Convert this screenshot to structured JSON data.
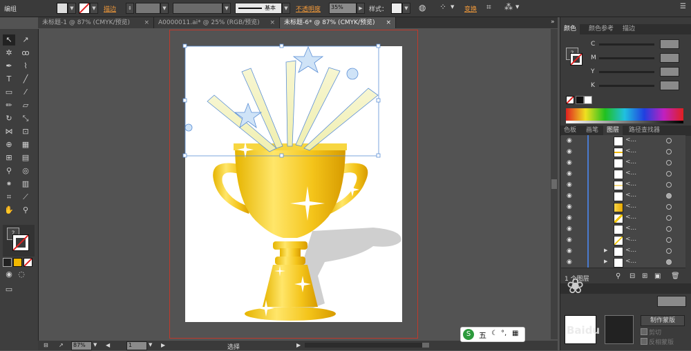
{
  "control_bar": {
    "label_group": "编组",
    "stroke_label": "描边",
    "stroke_style": "基本",
    "opacity_label": "不透明度",
    "opacity_value": "35%",
    "style_label": "样式：",
    "transform_label": "变换"
  },
  "tabs": [
    {
      "label": "未标题-1 @ 87% (CMYK/预览)",
      "close": "×"
    },
    {
      "label": "A0000011.ai* @ 25% (RGB/预览)",
      "close": "×"
    },
    {
      "label": "未标题-6* @ 87% (CMYK/预览)",
      "close": "×"
    }
  ],
  "color_panel": {
    "tabs": [
      "颜色",
      "颜色参考",
      "描边"
    ],
    "channels": [
      "C",
      "M",
      "Y",
      "K"
    ]
  },
  "layers_panel": {
    "tabs": [
      "色板",
      "画笔",
      "图层",
      "路径查找器"
    ],
    "row_label": "<...",
    "footer_label": "1 个图层"
  },
  "transparency_panel": {
    "make_mask": "制作蒙版",
    "clip": "剪切",
    "invert_mask": "反相蒙版"
  },
  "status_bar": {
    "zoom": "87%",
    "page": "1",
    "tool": "选择"
  },
  "ime": {
    "label": "五"
  },
  "watermark": "Baidu"
}
